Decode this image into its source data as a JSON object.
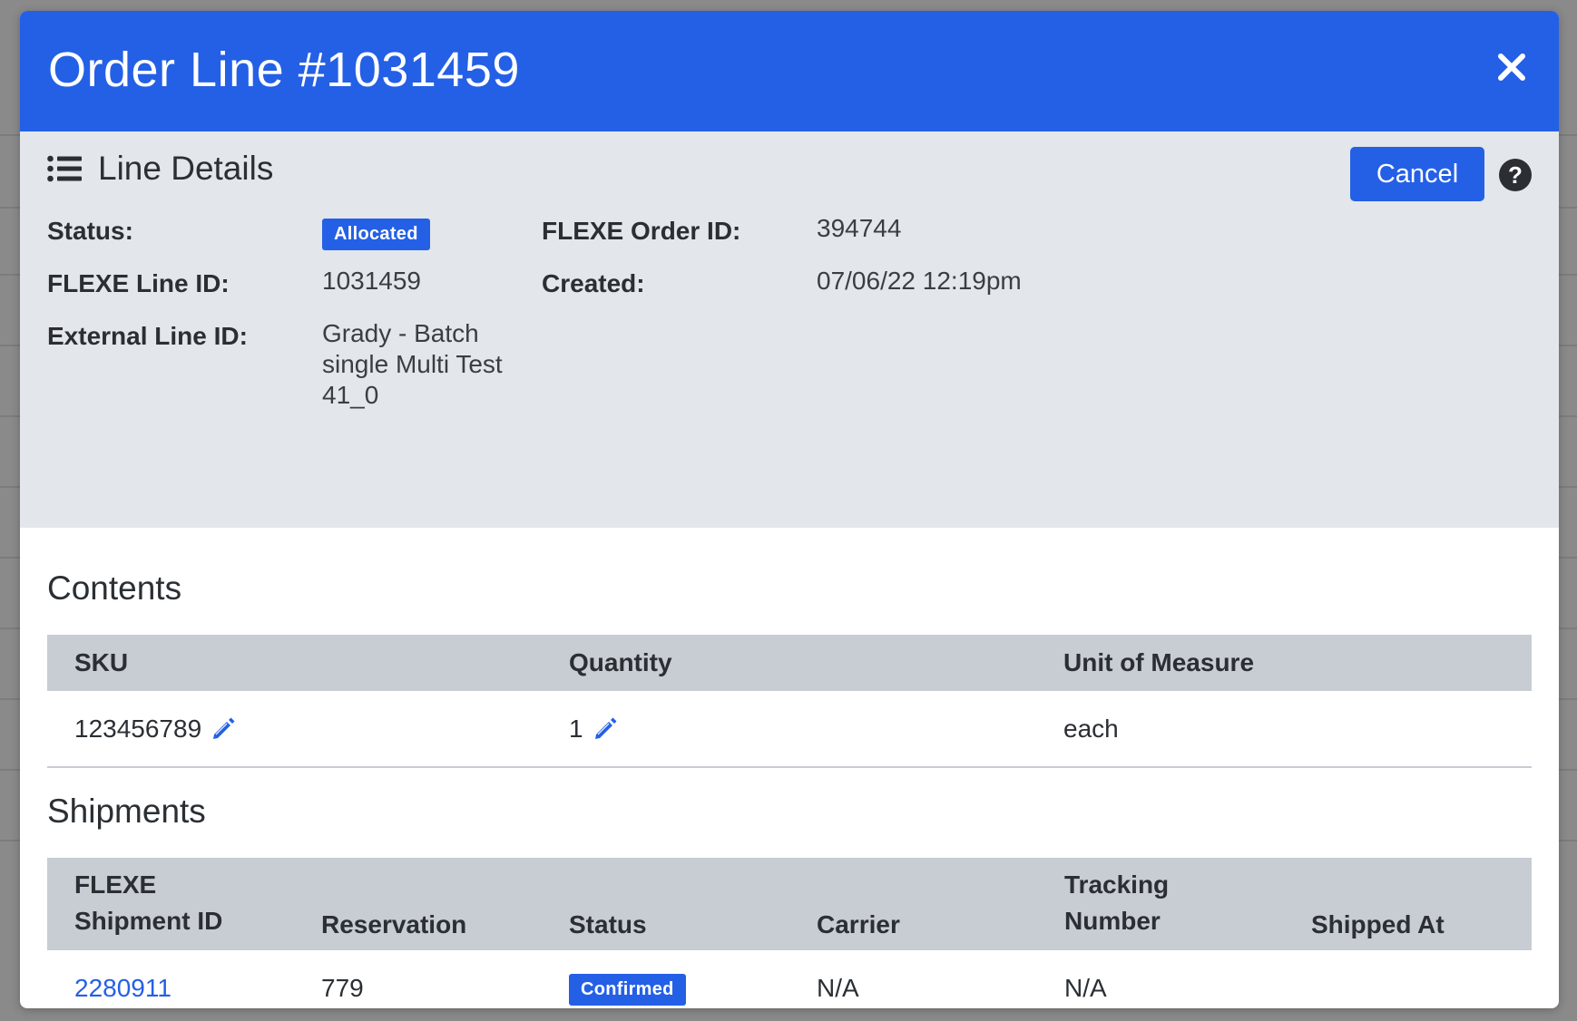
{
  "modal": {
    "title": "Order Line #1031459",
    "close_icon": "close-icon"
  },
  "details": {
    "section_title": "Line Details",
    "cancel_label": "Cancel",
    "help_icon": "question-circle-icon",
    "status_label": "Status:",
    "status_value": "Allocated",
    "order_id_label": "FLEXE Order ID:",
    "order_id_value": "394744",
    "line_id_label": "FLEXE Line ID:",
    "line_id_value": "1031459",
    "created_label": "Created:",
    "created_value": "07/06/22 12:19pm",
    "external_id_label": "External Line ID:",
    "external_id_lines": [
      "Grady - Batch",
      "single Multi Test",
      "41_0"
    ]
  },
  "contents": {
    "title": "Contents",
    "columns": [
      "SKU",
      "Quantity",
      "Unit of Measure"
    ],
    "rows": [
      {
        "sku": "123456789",
        "quantity": "1",
        "uom": "each"
      }
    ]
  },
  "shipments": {
    "title": "Shipments",
    "columns": [
      [
        "FLEXE",
        "Shipment ID"
      ],
      [
        "Reservation"
      ],
      [
        "Status"
      ],
      [
        "Carrier"
      ],
      [
        "Tracking",
        "Number"
      ],
      [
        "Shipped At"
      ]
    ],
    "rows": [
      {
        "shipment_id": "2280911",
        "reservation": "779",
        "status": "Confirmed",
        "carrier": "N/A",
        "tracking": "N/A",
        "shipped_at": ""
      }
    ]
  },
  "colors": {
    "primary": "#2460e6",
    "details_bg": "#e3e6ea",
    "table_header_bg": "#c8ccd3"
  }
}
